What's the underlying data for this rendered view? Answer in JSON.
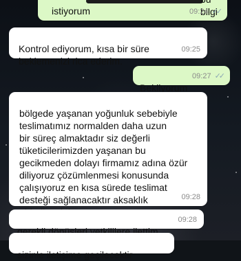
{
  "chat": {
    "messages": [
      {
        "text": "bu bilgi",
        "direction": "outgoing"
      },
      {
        "text": "istiyorum",
        "time": "09:24",
        "direction": "outgoing"
      },
      {
        "text": "Kontrol ediyorum, kısa bir süre\nbeklemenizi rica ederim.",
        "time": "09:25",
        "direction": "incoming"
      },
      {
        "text": "Bekliyorum",
        "time": "09:27",
        "direction": "outgoing"
      },
      {
        "text": "bölgede yaşanan yoğunluk sebebiyle\nteslimatımız normalden daha uzun\nbir süreç almaktadır siz değerli\ntüketicilerimizden yaşanan bu\ngecikmeden dolayı firmamız adına özür\ndiliyoruz çözümlenmesi konusunda\nçalışıyoruz en kısa sürede teslimat\ndesteği sağlanacaktır aksaklık\ngiderilecektir",
        "time": "09:28",
        "direction": "incoming"
      },
      {
        "text": "gerekli dönüşleri yetkililere ilettim",
        "time": "09:28",
        "direction": "incoming"
      },
      {
        "text": "sizinle iletişime geçilecektir",
        "direction": "incoming"
      }
    ]
  },
  "icons": {
    "read_receipt": "double-check-icon",
    "ticks_glyph": "✓✓"
  },
  "colors": {
    "incoming_bubble": "#ffffff",
    "outgoing_bubble": "#dcf8c6",
    "read_ticks": "#8aa7b3",
    "timestamp": "#8a8a8a"
  }
}
